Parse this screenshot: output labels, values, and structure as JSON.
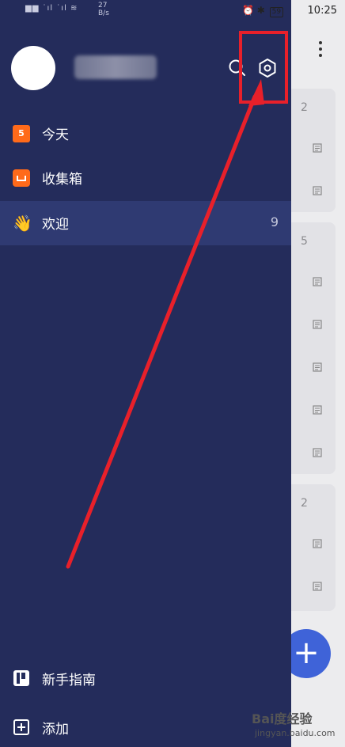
{
  "status_bar": {
    "signal_text": "▆▆ ˙ıl ˙ıl ≋",
    "net_speed": "27\nB/s",
    "battery": "59",
    "time": "10:25"
  },
  "drawer": {
    "menu": [
      {
        "label": "今天",
        "icon": "calendar-icon",
        "calendar_day": "5",
        "count": ""
      },
      {
        "label": "收集箱",
        "icon": "inbox-icon",
        "count": ""
      },
      {
        "label": "欢迎",
        "icon": "waving-hand-icon",
        "emoji": "👋",
        "count": "9"
      }
    ],
    "bottom": [
      {
        "label": "新手指南",
        "icon": "guide-icon"
      },
      {
        "label": "添加",
        "icon": "add-square-icon"
      }
    ]
  },
  "background_app": {
    "group_counts": [
      "2",
      "5",
      "2"
    ],
    "fab_label": "+"
  },
  "watermark": {
    "brand": "Bai度经验",
    "sub": "jingyan.baidu.com"
  },
  "colors": {
    "drawer_bg": "#242c5b",
    "active_item_bg": "#2f3a72",
    "accent_orange": "#ff6a1a",
    "fab_blue": "#3f63d8",
    "annotation_red": "#e8202a"
  }
}
